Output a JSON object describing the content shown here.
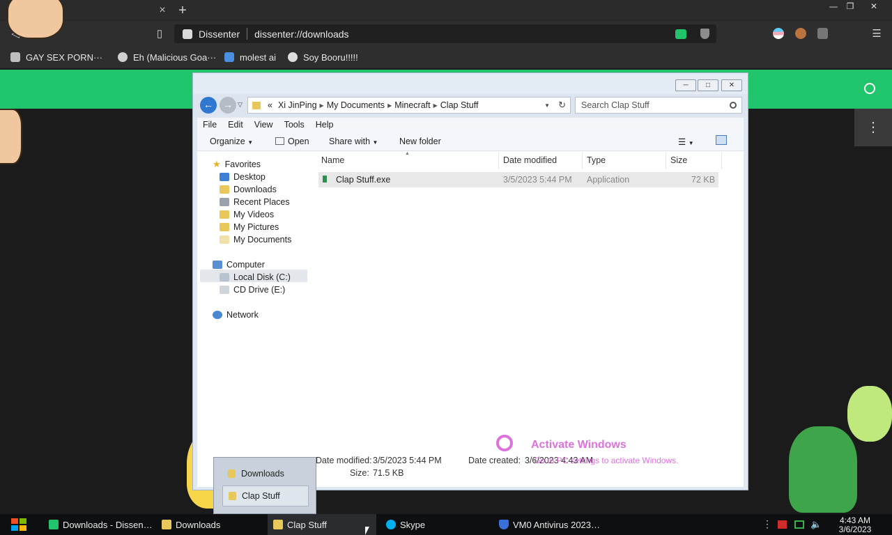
{
  "browser": {
    "app_name": "Dissenter",
    "url": "dissenter://downloads",
    "new_tab_symbol": "+",
    "close_tab_symbol": "×",
    "bookmarks": [
      {
        "label": "GAY SEX PORN···"
      },
      {
        "label": "Eh (Malicious Goa···"
      },
      {
        "label": "molest ai"
      },
      {
        "label": "Soy Booru!!!!!"
      }
    ]
  },
  "explorer": {
    "breadcrumb": {
      "prefix": "«",
      "items": [
        "Xi JinPing",
        "My Documents",
        "Minecraft",
        "Clap Stuff"
      ]
    },
    "search_placeholder": "Search Clap Stuff",
    "menu": [
      "File",
      "Edit",
      "View",
      "Tools",
      "Help"
    ],
    "commands": {
      "organize": "Organize",
      "open": "Open",
      "share_with": "Share with",
      "new_folder": "New folder"
    },
    "nav": {
      "favorites": "Favorites",
      "desktop": "Desktop",
      "downloads": "Downloads",
      "recent_places": "Recent Places",
      "my_videos": "My Videos",
      "my_pictures": "My Pictures",
      "my_documents": "My Documents",
      "computer": "Computer",
      "local_disk": "Local Disk (C:)",
      "cd_drive": "CD Drive (E:)",
      "network": "Network"
    },
    "columns": [
      "Name",
      "Date modified",
      "Type",
      "Size"
    ],
    "files": [
      {
        "name": "Clap Stuff.exe",
        "date_modified": "3/5/2023 5:44 PM",
        "type": "Application",
        "size": "72 KB"
      }
    ],
    "details": {
      "date_modified_label": "Date modified:",
      "date_modified_value": "3/5/2023 5:44 PM",
      "size_label": "Size:",
      "size_value": "71.5 KB",
      "date_created_label": "Date created:",
      "date_created_value": "3/6/2023 4:43 AM"
    }
  },
  "jump_popup": {
    "items": [
      "Downloads",
      "Clap Stuff"
    ]
  },
  "watermark": {
    "line1": "Activate Windows",
    "line2": "Go to PC settings to activate Windows."
  },
  "taskbar": {
    "items": [
      {
        "label": "Downloads - Dissen…"
      },
      {
        "label": "Downloads"
      },
      {
        "label": "Clap Stuff"
      },
      {
        "label": "Skype"
      },
      {
        "label": "VM0 Antivirus 2023…"
      }
    ],
    "time": "4:43 AM",
    "date": "3/6/2023"
  },
  "colors": {
    "accent_green": "#1fc46b",
    "taskbar": "#0e0f10",
    "nav_back": "#2f77d0"
  }
}
